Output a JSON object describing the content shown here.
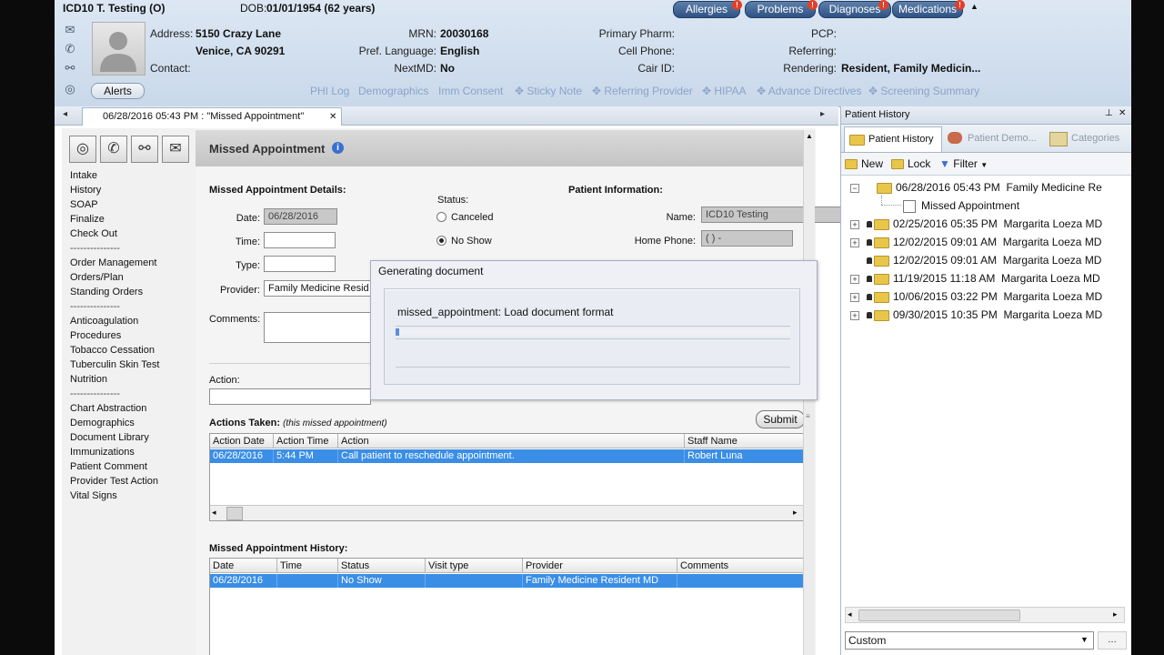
{
  "patient": {
    "name": "ICD10 T. Testing (O)",
    "dob_label": "DOB:",
    "dob_value": "01/01/1954 (62 years)",
    "address_label": "Address:",
    "address_line1": "5150 Crazy Lane",
    "address_line2": "Venice, CA 90291",
    "contact_label": "Contact:",
    "mrn_label": "MRN:",
    "mrn_value": "20030168",
    "pref_lang_label": "Pref. Language:",
    "pref_lang_value": "English",
    "nextmd_label": "NextMD:",
    "nextmd_value": "No",
    "primary_pharm_label": "Primary Pharm:",
    "cell_phone_label": "Cell Phone:",
    "cair_label": "Cair ID:",
    "pcp_label": "PCP:",
    "referring_label": "Referring:",
    "rendering_label": "Rendering:",
    "rendering_value": "Resident, Family Medicin..."
  },
  "header_buttons": {
    "allergies": "Allergies",
    "problems": "Problems",
    "diagnoses": "Diagnoses",
    "medications": "Medications",
    "badge": "!",
    "collapse": "▲"
  },
  "alerts_button": "Alerts",
  "header_links": [
    "PHI Log",
    "Demographics",
    "Imm Consent",
    "Sticky Note",
    "Referring Provider",
    "HIPAA",
    "Advance Directives",
    "Screening Summary"
  ],
  "doc_tab": {
    "title": "06/28/2016 05:43 PM : \"Missed Appointment\"",
    "close": "✕",
    "nav_left": "◂",
    "nav_right": "▸"
  },
  "leftnav": {
    "group1": [
      "Intake",
      "History",
      "SOAP",
      "Finalize",
      "Check Out"
    ],
    "sep": "---------------",
    "group2": [
      "Order Management",
      "Orders/Plan",
      "Standing Orders"
    ],
    "group3": [
      "Anticoagulation",
      "Procedures",
      "Tobacco Cessation",
      "Tuberculin Skin Test",
      "Nutrition"
    ],
    "group4": [
      "Chart Abstraction",
      "Demographics",
      "Document Library",
      "Immunizations",
      "Patient Comment",
      "Provider Test Action",
      "Vital Signs"
    ]
  },
  "form": {
    "title": "Missed Appointment",
    "info_icon": "i",
    "details_heading": "Missed Appointment Details:",
    "date_label": "Date:",
    "date_value": "06/28/2016",
    "time_label": "Time:",
    "type_label": "Type:",
    "provider_label": "Provider:",
    "provider_value": "Family Medicine Resid",
    "comments_label": "Comments:",
    "status_label": "Status:",
    "status_canceled": "Canceled",
    "status_noshow": "No Show",
    "patient_info_heading": "Patient Information:",
    "pi_name_label": "Name:",
    "pi_name_value": "ICD10 Testing",
    "pi_home_phone_label": "Home Phone:",
    "pi_home_phone_value": "(   )   -",
    "action_label": "Action:",
    "submit": "Submit",
    "actions_taken_label": "Actions Taken:",
    "actions_taken_note": "(this missed appointment)",
    "actions_cols": [
      "Action Date",
      "Action Time",
      "Action",
      "Staff Name"
    ],
    "actions_rows": [
      [
        "06/28/2016",
        "5:44 PM",
        "Call patient to reschedule appointment.",
        "Robert Luna"
      ]
    ],
    "history_label": "Missed Appointment History:",
    "history_cols": [
      "Date",
      "Time",
      "Status",
      "Visit type",
      "Provider",
      "Comments"
    ],
    "history_rows": [
      [
        "06/28/2016",
        "",
        "No Show",
        "",
        "Family Medicine Resident MD",
        ""
      ]
    ]
  },
  "dialog": {
    "title": "Generating document",
    "message": "missed_appointment: Load document format",
    "progress": 0.01
  },
  "right_panel": {
    "title": "Patient History",
    "pin": "⊥",
    "close": "✕",
    "tabs": [
      "Patient History",
      "Patient Demo...",
      "Categories"
    ],
    "toolbar": {
      "new": "New",
      "lock": "Lock",
      "filter": "Filter"
    },
    "tree": [
      {
        "date": "06/28/2016 05:43 PM",
        "who": "Family Medicine Re",
        "expanded": true,
        "locked": false
      },
      {
        "child": "Missed Appointment"
      },
      {
        "date": "02/25/2016 05:35 PM",
        "who": "Margarita Loeza MD",
        "expanded": false,
        "locked": true
      },
      {
        "date": "12/02/2015 09:01 AM",
        "who": "Margarita Loeza MD",
        "expanded": false,
        "locked": true
      },
      {
        "date": "12/02/2015 09:01 AM",
        "who": "Margarita Loeza MD",
        "expanded": false,
        "locked": true
      },
      {
        "date": "11/19/2015 11:18 AM",
        "who": "Margarita Loeza MD",
        "expanded": false,
        "locked": true
      },
      {
        "date": "10/06/2015 03:22 PM",
        "who": "Margarita Loeza MD",
        "expanded": false,
        "locked": true
      },
      {
        "date": "09/30/2015 10:35 PM",
        "who": "Margarita Loeza MD",
        "expanded": false,
        "locked": true
      }
    ],
    "view_select": "Custom"
  },
  "colors": {
    "header_bg": "#cfdcec",
    "pill": "#3d6294",
    "selection": "#3a8ee6",
    "badge": "#e0402a"
  }
}
